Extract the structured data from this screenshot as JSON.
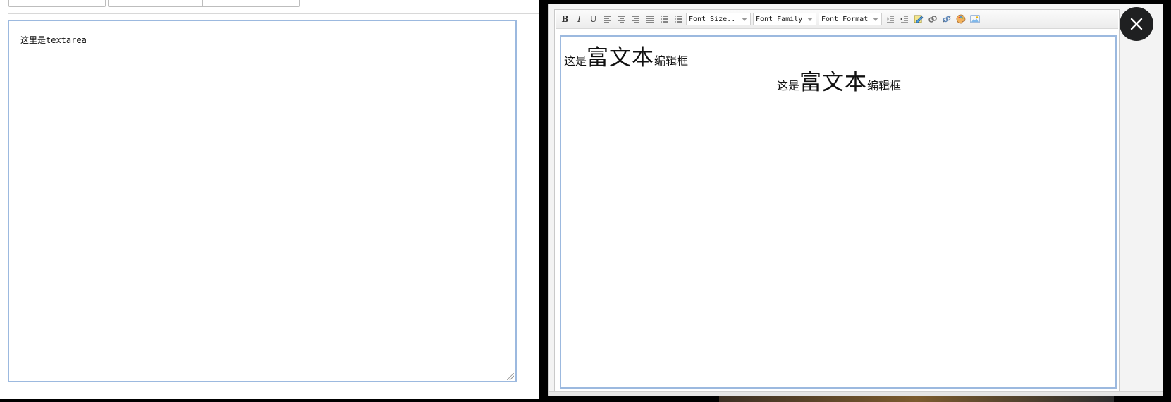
{
  "left_editor": {
    "textarea_value": "这里是textarea"
  },
  "rich_editor": {
    "toolbar": {
      "bold": "B",
      "italic": "I",
      "underline": "U",
      "font_size": "Font Size..",
      "font_family": "Font Family",
      "font_format": "Font Format"
    },
    "content": {
      "line1_prefix": "这是",
      "line1_large": "富文本",
      "line1_suffix": "编辑框",
      "line2_prefix": "这是",
      "line2_large": "富文本",
      "line2_suffix": "编辑框"
    }
  },
  "icons": {
    "close": "close-icon",
    "align_left": "align-left-icon",
    "align_center": "align-center-icon",
    "align_right": "align-right-icon",
    "justify": "align-justify-icon",
    "ordered_list": "ordered-list-icon",
    "unordered_list": "unordered-list-icon",
    "indent": "indent-icon",
    "outdent": "outdent-icon",
    "edit_html": "edit-icon",
    "link": "link-icon",
    "unlink": "unlink-icon",
    "color": "color-palette-icon",
    "image": "image-icon"
  },
  "colors": {
    "textarea_border": "#9cb9df",
    "close_button_bg": "#1f2021"
  }
}
